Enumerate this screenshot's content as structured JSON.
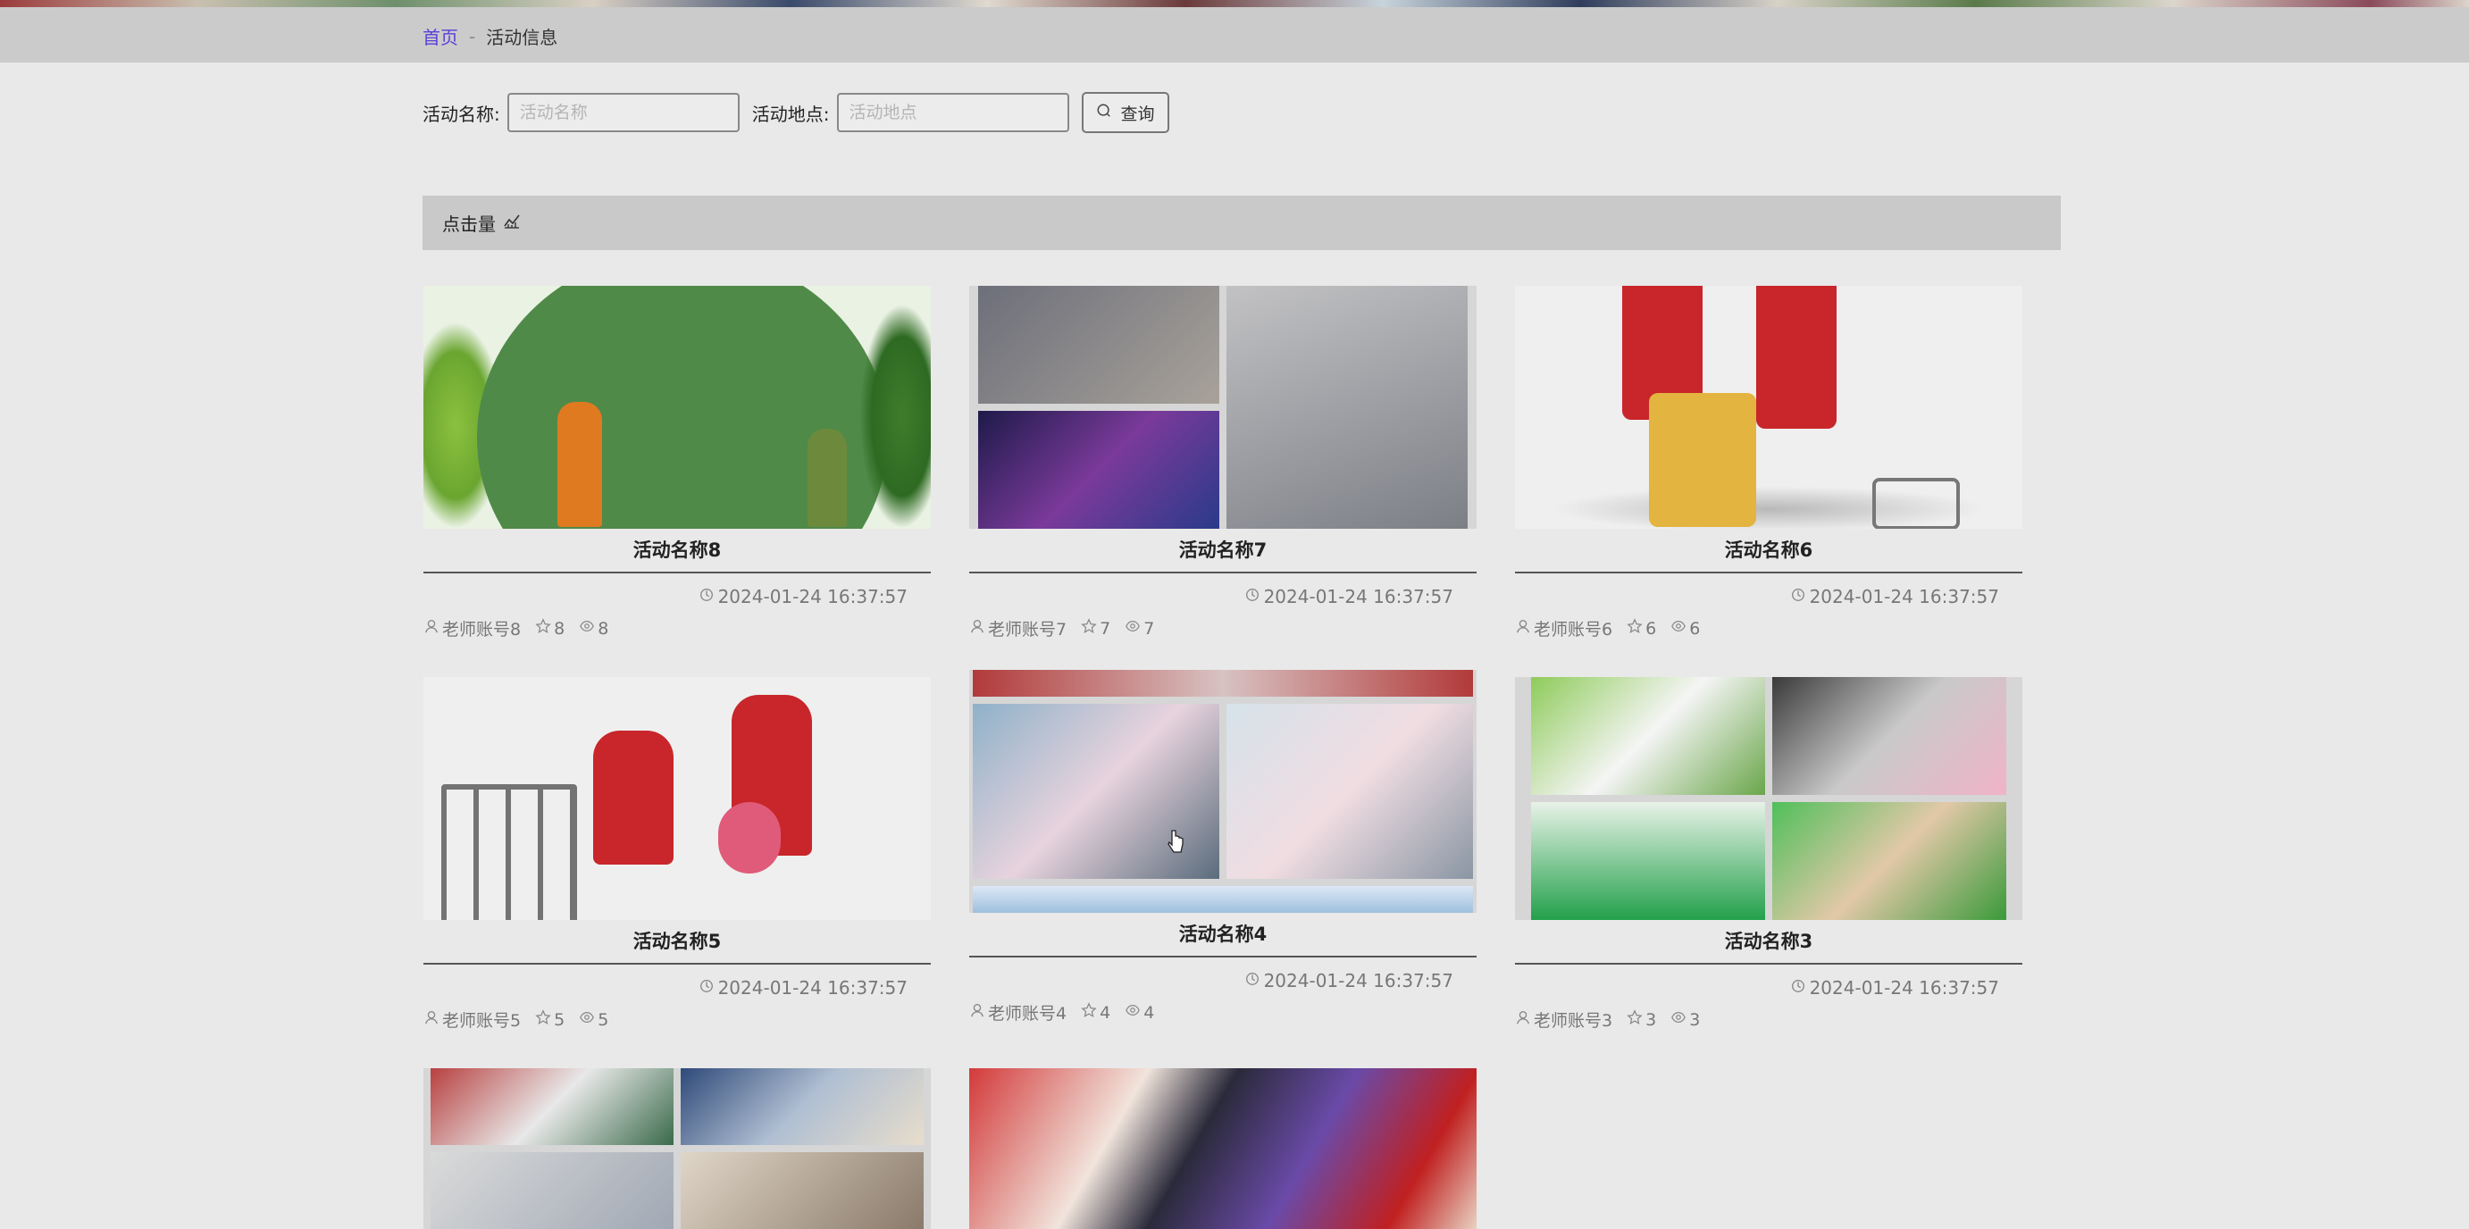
{
  "breadcrumb": {
    "home": "首页",
    "separator": "-",
    "current": "活动信息"
  },
  "search": {
    "name_label": "活动名称:",
    "name_placeholder": "活动名称",
    "location_label": "活动地点:",
    "location_placeholder": "活动地点",
    "query_button": "查询"
  },
  "section": {
    "title": "点击量"
  },
  "cards": [
    {
      "title": "活动名称8",
      "time": "2024-01-24 16:37:57",
      "author": "老师账号8",
      "stars": "8",
      "views": "8"
    },
    {
      "title": "活动名称7",
      "time": "2024-01-24 16:37:57",
      "author": "老师账号7",
      "stars": "7",
      "views": "7"
    },
    {
      "title": "活动名称6",
      "time": "2024-01-24 16:37:57",
      "author": "老师账号6",
      "stars": "6",
      "views": "6"
    },
    {
      "title": "活动名称5",
      "time": "2024-01-24 16:37:57",
      "author": "老师账号5",
      "stars": "5",
      "views": "5"
    },
    {
      "title": "活动名称4",
      "time": "2024-01-24 16:37:57",
      "author": "老师账号4",
      "stars": "4",
      "views": "4"
    },
    {
      "title": "活动名称3",
      "time": "2024-01-24 16:37:57",
      "author": "老师账号3",
      "stars": "3",
      "views": "3"
    }
  ],
  "colors": {
    "accent": "#5b3fd6",
    "header_bg": "#cbcbcb",
    "page_bg": "#e9e9e9"
  }
}
